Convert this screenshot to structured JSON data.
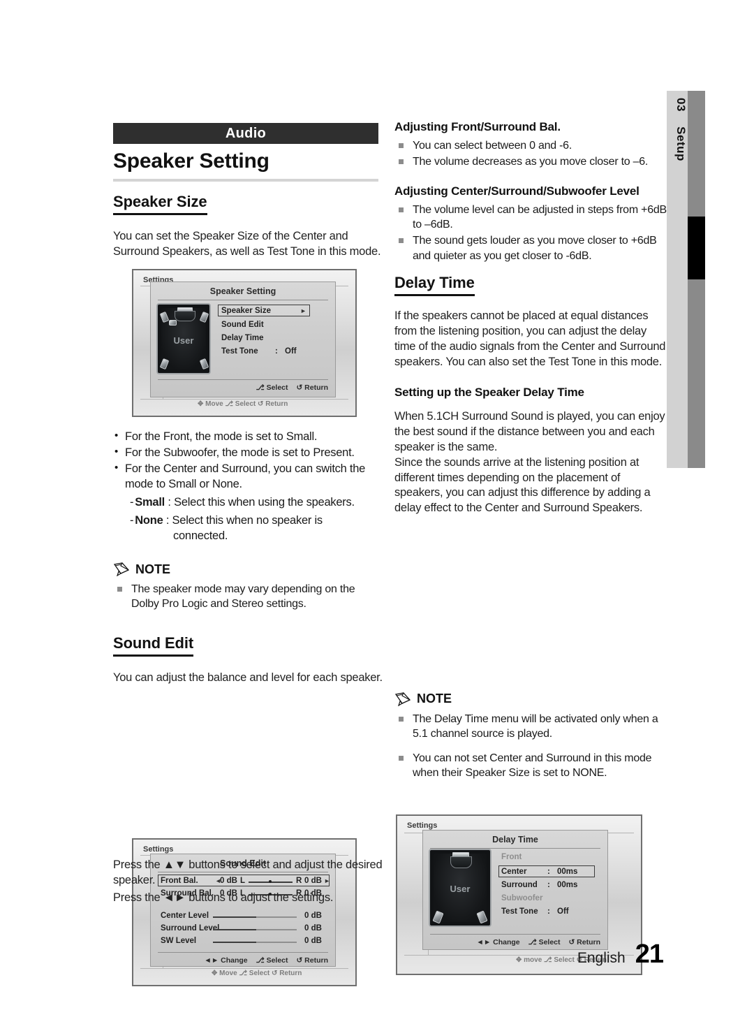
{
  "page": {
    "section_tab_number": "03",
    "section_tab_label": "Setup",
    "footer_language": "English",
    "footer_page_number": "21",
    "accent_header_bg": "#2f2f2f",
    "tab_bg": "#d2d2d2",
    "tab_bar": "#8a8a8a"
  },
  "left": {
    "category_bar": "Audio",
    "title": "Speaker Setting",
    "speaker_size": {
      "heading": "Speaker Size",
      "intro": "You can set the Speaker Size of the Center and Surround Speakers, as well as Test Tone in this mode.",
      "bullets": [
        "For the Front, the mode is set to Small.",
        "For the Subwoofer, the mode is set to Present.",
        "For the Center and Surround, you can switch the mode to Small or None."
      ],
      "sub_items": [
        {
          "dash": "-",
          "term": "Small",
          "sep": ":",
          "text": "Select this when using the speakers."
        },
        {
          "dash": "-",
          "term": "None",
          "sep": ":",
          "text": "Select this when no speaker is",
          "cont": "connected."
        }
      ],
      "note_label": "NOTE",
      "notes": [
        "The speaker mode may vary depending on the Dolby Pro Logic and Stereo settings."
      ]
    },
    "sound_edit": {
      "heading": "Sound Edit",
      "intro": "You can adjust the balance and level for each speaker.",
      "after_text_1": "Press the ▲▼ buttons to select and adjust the desired speaker.",
      "after_text_2": "Press the ◄► buttons to adjust the settings."
    }
  },
  "right": {
    "front_surround": {
      "heading": "Adjusting Front/Surround Bal.",
      "notes": [
        "You can select between 0 and -6.",
        "The volume decreases as you move closer to –6."
      ]
    },
    "center_level": {
      "heading": "Adjusting Center/Surround/Subwoofer Level",
      "notes": [
        "The volume level can be adjusted in steps from +6dB to –6dB.",
        "The sound gets louder as you move closer to +6dB and quieter as you get closer to -6dB."
      ]
    },
    "delay_time": {
      "heading": "Delay Time",
      "intro": "If the speakers cannot be placed at equal distances from the listening position, you can adjust the delay time of the audio signals from the Center and Surround speakers. You can also set the Test Tone in this mode.",
      "sub_heading": "Setting up the Speaker Delay Time",
      "body_1": "When 5.1CH Surround Sound is played, you can enjoy the best sound if the distance between you and each speaker is the same.",
      "body_2": "Since the sounds arrive at the listening position at different times depending on the placement of speakers, you can adjust this difference by adding a delay effect to the Center and Surround Speakers.",
      "note_label": "NOTE",
      "notes": [
        "The Delay Time menu will be activated only when a 5.1 channel source is played.",
        "You can not set Center and Surround in this mode when their Speaker Size is set to NONE."
      ]
    }
  },
  "screenshots": {
    "speaker_setting": {
      "settings_word": "Settings",
      "dialog_title": "Speaker Setting",
      "room_label": "User",
      "menu": [
        {
          "label": "Speaker Size",
          "sep": "",
          "value": "",
          "selected": true,
          "arrow": "►"
        },
        {
          "label": "Sound Edit",
          "sep": "",
          "value": "",
          "selected": false,
          "arrow": ""
        },
        {
          "label": "Delay Time",
          "sep": "",
          "value": "",
          "selected": false,
          "arrow": ""
        },
        {
          "label": "Test Tone",
          "sep": ":",
          "value": "Off",
          "selected": false,
          "arrow": ""
        }
      ],
      "footer_hints": [
        "⎇ Select",
        "↺ Return"
      ],
      "ghost_footer": "✥ Move    ⎇ Select    ↺ Return"
    },
    "sound_edit": {
      "settings_word": "Settings",
      "dialog_title": "Sound Edit",
      "balance_rows": [
        {
          "label": "Front Bal.",
          "left_val": "0 dB",
          "left_ch": "L",
          "right_ch": "R",
          "right_val": "0 dB",
          "selected": true
        },
        {
          "label": "Surround Bal.",
          "left_val": "0 dB",
          "left_ch": "L",
          "right_ch": "R",
          "right_val": "0 dB",
          "selected": false
        }
      ],
      "level_rows": [
        {
          "label": "Center Level",
          "value": "0 dB"
        },
        {
          "label": "Surround Level",
          "value": "0 dB"
        },
        {
          "label": "SW Level",
          "value": "0 dB"
        }
      ],
      "footer_hints": [
        "◄► Change",
        "⎇ Select",
        "↺ Return"
      ],
      "ghost_footer": "✥ Move    ⎇ Select    ↺ Return"
    },
    "delay_time": {
      "settings_word": "Settings",
      "dialog_title": "Delay Time",
      "room_label": "User",
      "menu": [
        {
          "label": "Front",
          "sep": "",
          "value": "",
          "selected": false,
          "dim": true
        },
        {
          "label": "Center",
          "sep": ":",
          "value": "00ms",
          "selected": true,
          "dim": false
        },
        {
          "label": "Surround",
          "sep": ":",
          "value": "00ms",
          "selected": false,
          "dim": false
        },
        {
          "label": "Subwoofer",
          "sep": "",
          "value": "",
          "selected": false,
          "dim": true
        },
        {
          "label": "Test Tone",
          "sep": ":",
          "value": "Off",
          "selected": false,
          "dim": false
        }
      ],
      "footer_hints": [
        "◄► Change",
        "⎇ Select",
        "↺ Return"
      ],
      "ghost_footer": "✥ move    ⎇ Select    ↺ Return"
    }
  }
}
